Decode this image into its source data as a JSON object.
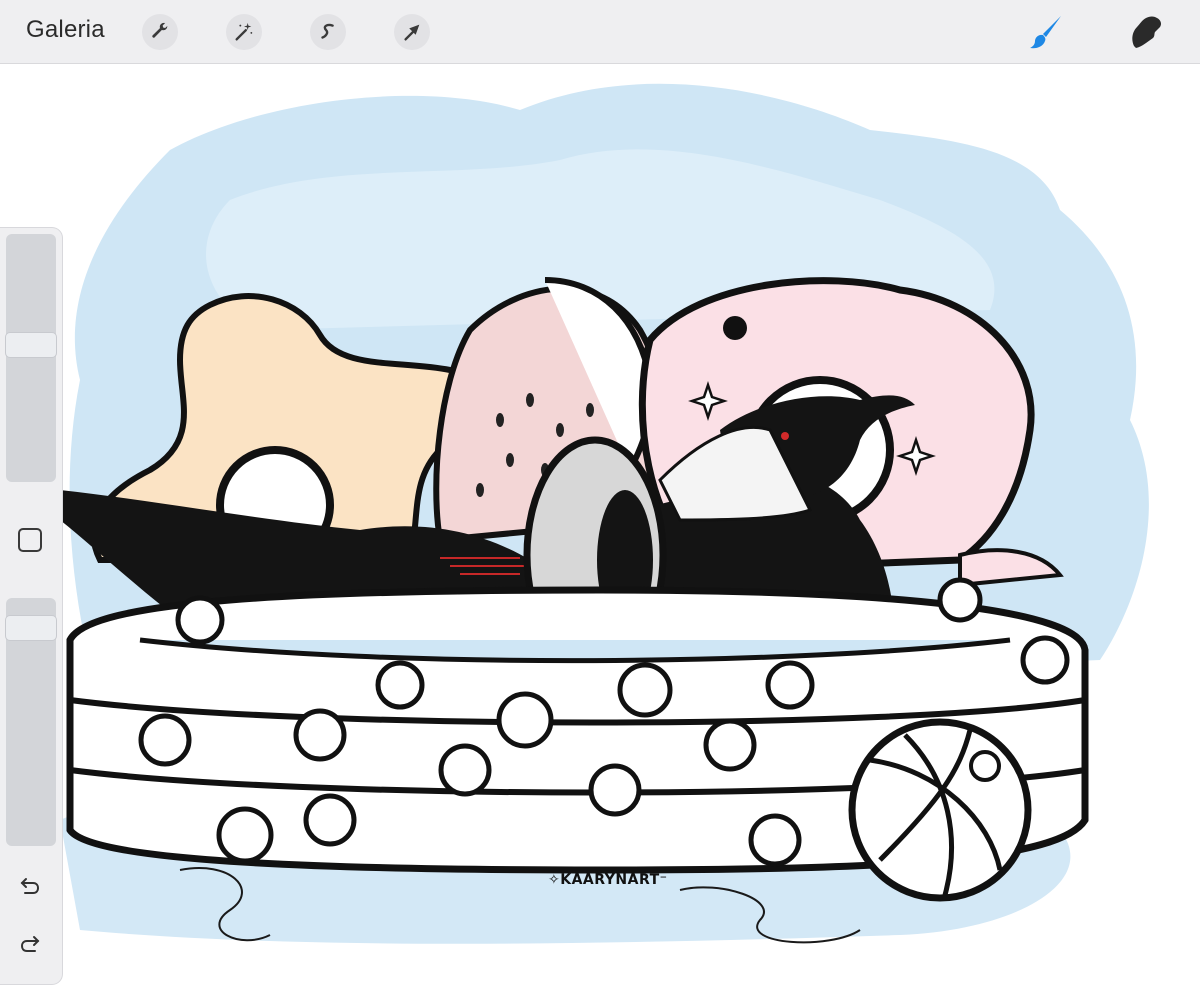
{
  "toolbar": {
    "gallery_label": "Galeria",
    "tools": [
      "wrench-icon",
      "magic-wand-icon",
      "selection-icon",
      "transform-arrow-icon"
    ],
    "brush_active_color": "#1e88e5",
    "right_tools": [
      "brush-icon",
      "smudge-icon"
    ]
  },
  "sidebar": {
    "brush_size": 0.56,
    "opacity": 0.92,
    "buttons": [
      "modify-square-icon",
      "undo-icon",
      "redo-icon"
    ]
  },
  "canvas": {
    "signature": "✧KAARYNART⁻"
  }
}
